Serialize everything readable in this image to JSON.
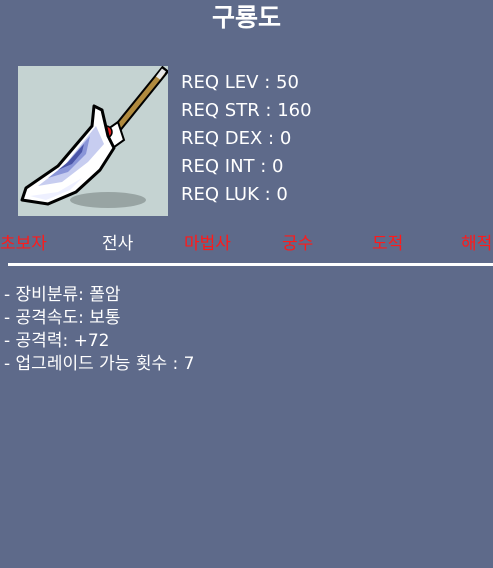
{
  "item": {
    "name": "구룡도",
    "icon": "polearm-blade-icon",
    "requirements": [
      "REQ LEV : 50",
      "REQ STR : 160",
      "REQ DEX : 0",
      "REQ INT : 0",
      "REQ LUK : 0"
    ],
    "jobs": [
      {
        "label": "초보자",
        "allowed": false
      },
      {
        "label": "전사",
        "allowed": true
      },
      {
        "label": "마법사",
        "allowed": false
      },
      {
        "label": "궁수",
        "allowed": false
      },
      {
        "label": "도적",
        "allowed": false
      },
      {
        "label": "해적",
        "allowed": false
      }
    ],
    "stats": [
      "- 장비분류: 폴암",
      "- 공격속도: 보통",
      "- 공격력: +72",
      "- 업그레이드 가능 횟수 : 7"
    ]
  },
  "colors": {
    "background": "#5e6a8a",
    "job_allowed": "#ffffff",
    "job_disallowed": "#ff1a1a"
  }
}
